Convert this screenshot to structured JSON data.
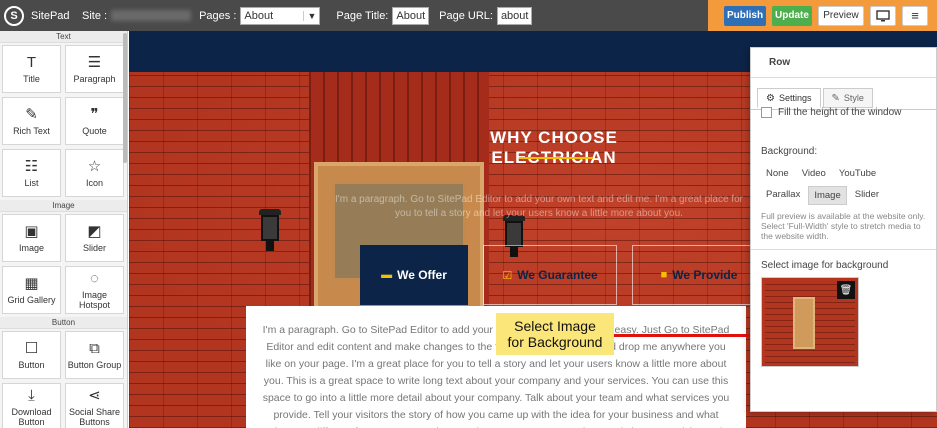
{
  "topbar": {
    "brand": "SitePad",
    "site_label": "Site :",
    "pages_label": "Pages :",
    "pages_selected": "About",
    "page_title_label": "Page Title:",
    "page_title_value": "About",
    "page_url_label": "Page URL:",
    "page_url_value": "about",
    "publish": "Publish",
    "update": "Update",
    "preview": "Preview",
    "monitor_icon": "monitor-icon",
    "menu_icon": "hamburger-icon"
  },
  "leftpanel": {
    "sections": {
      "text": "Text",
      "image": "Image",
      "button": "Button"
    },
    "tiles": {
      "title": "Title",
      "paragraph": "Paragraph",
      "rich_text": "Rich Text",
      "quote": "Quote",
      "list": "List",
      "icon": "Icon",
      "image": "Image",
      "slider": "Slider",
      "grid_gallery": "Grid Gallery",
      "image_hotspot": "Image Hotspot",
      "button": "Button",
      "button_group": "Button Group",
      "download_button": "Download Button",
      "social_share_buttons": "Social Share Buttons"
    }
  },
  "canvas": {
    "heading": "WHY CHOOSE ELECTRICIAN",
    "faint_text": "I'm a paragraph. Go to SitePad Editor to add your own text and edit me. I'm a great place for you to tell a story and let your users know a little more about you.",
    "tabs": {
      "offer": "We Offer",
      "guarantee": "We Guarantee",
      "provide": "We Provide"
    },
    "paragraph": "I'm a paragraph. Go to SitePad Editor to add your own text and edit me. It's easy. Just Go to SitePad Editor and edit content and make changes to the font. Feel free to drag and drop me anywhere you like on your page. I'm a great place for you to tell a story and let your users know a little more about you. This is a great space to write long text about your company and your services. You can use this space to go into a little more detail about your company. Talk about your team and what services you provide. Tell your visitors the story of how you came up with the idea for your business and what makes you different from your competitors. Make your company stand out and show your visitors who you are."
  },
  "callout": {
    "line1": "Select Image",
    "line2": "for Background",
    "color": "#fbe67a",
    "arrow_color": "#e01010"
  },
  "rightpanel": {
    "header": "Row",
    "tab_settings": "Settings",
    "tab_style": "Style",
    "fill_height": "Fill the height of the window",
    "background_label": "Background:",
    "bg_options": [
      "None",
      "Video",
      "YouTube",
      "Parallax",
      "Image",
      "Slider"
    ],
    "bg_selected": "Image",
    "note": "Full preview is available at the website only. Select 'Full-Width' style to stretch media to the website width.",
    "select_image_label": "Select image for background",
    "trash_icon": "trash-icon"
  },
  "colors": {
    "topbar": "#4a4a4a",
    "actions_bg": "#f39a3c",
    "publish": "#2e6fb5",
    "update": "#4cae4c",
    "navy": "#0c2447",
    "accent_yellow": "#f2c200",
    "brick": "#b23520"
  }
}
